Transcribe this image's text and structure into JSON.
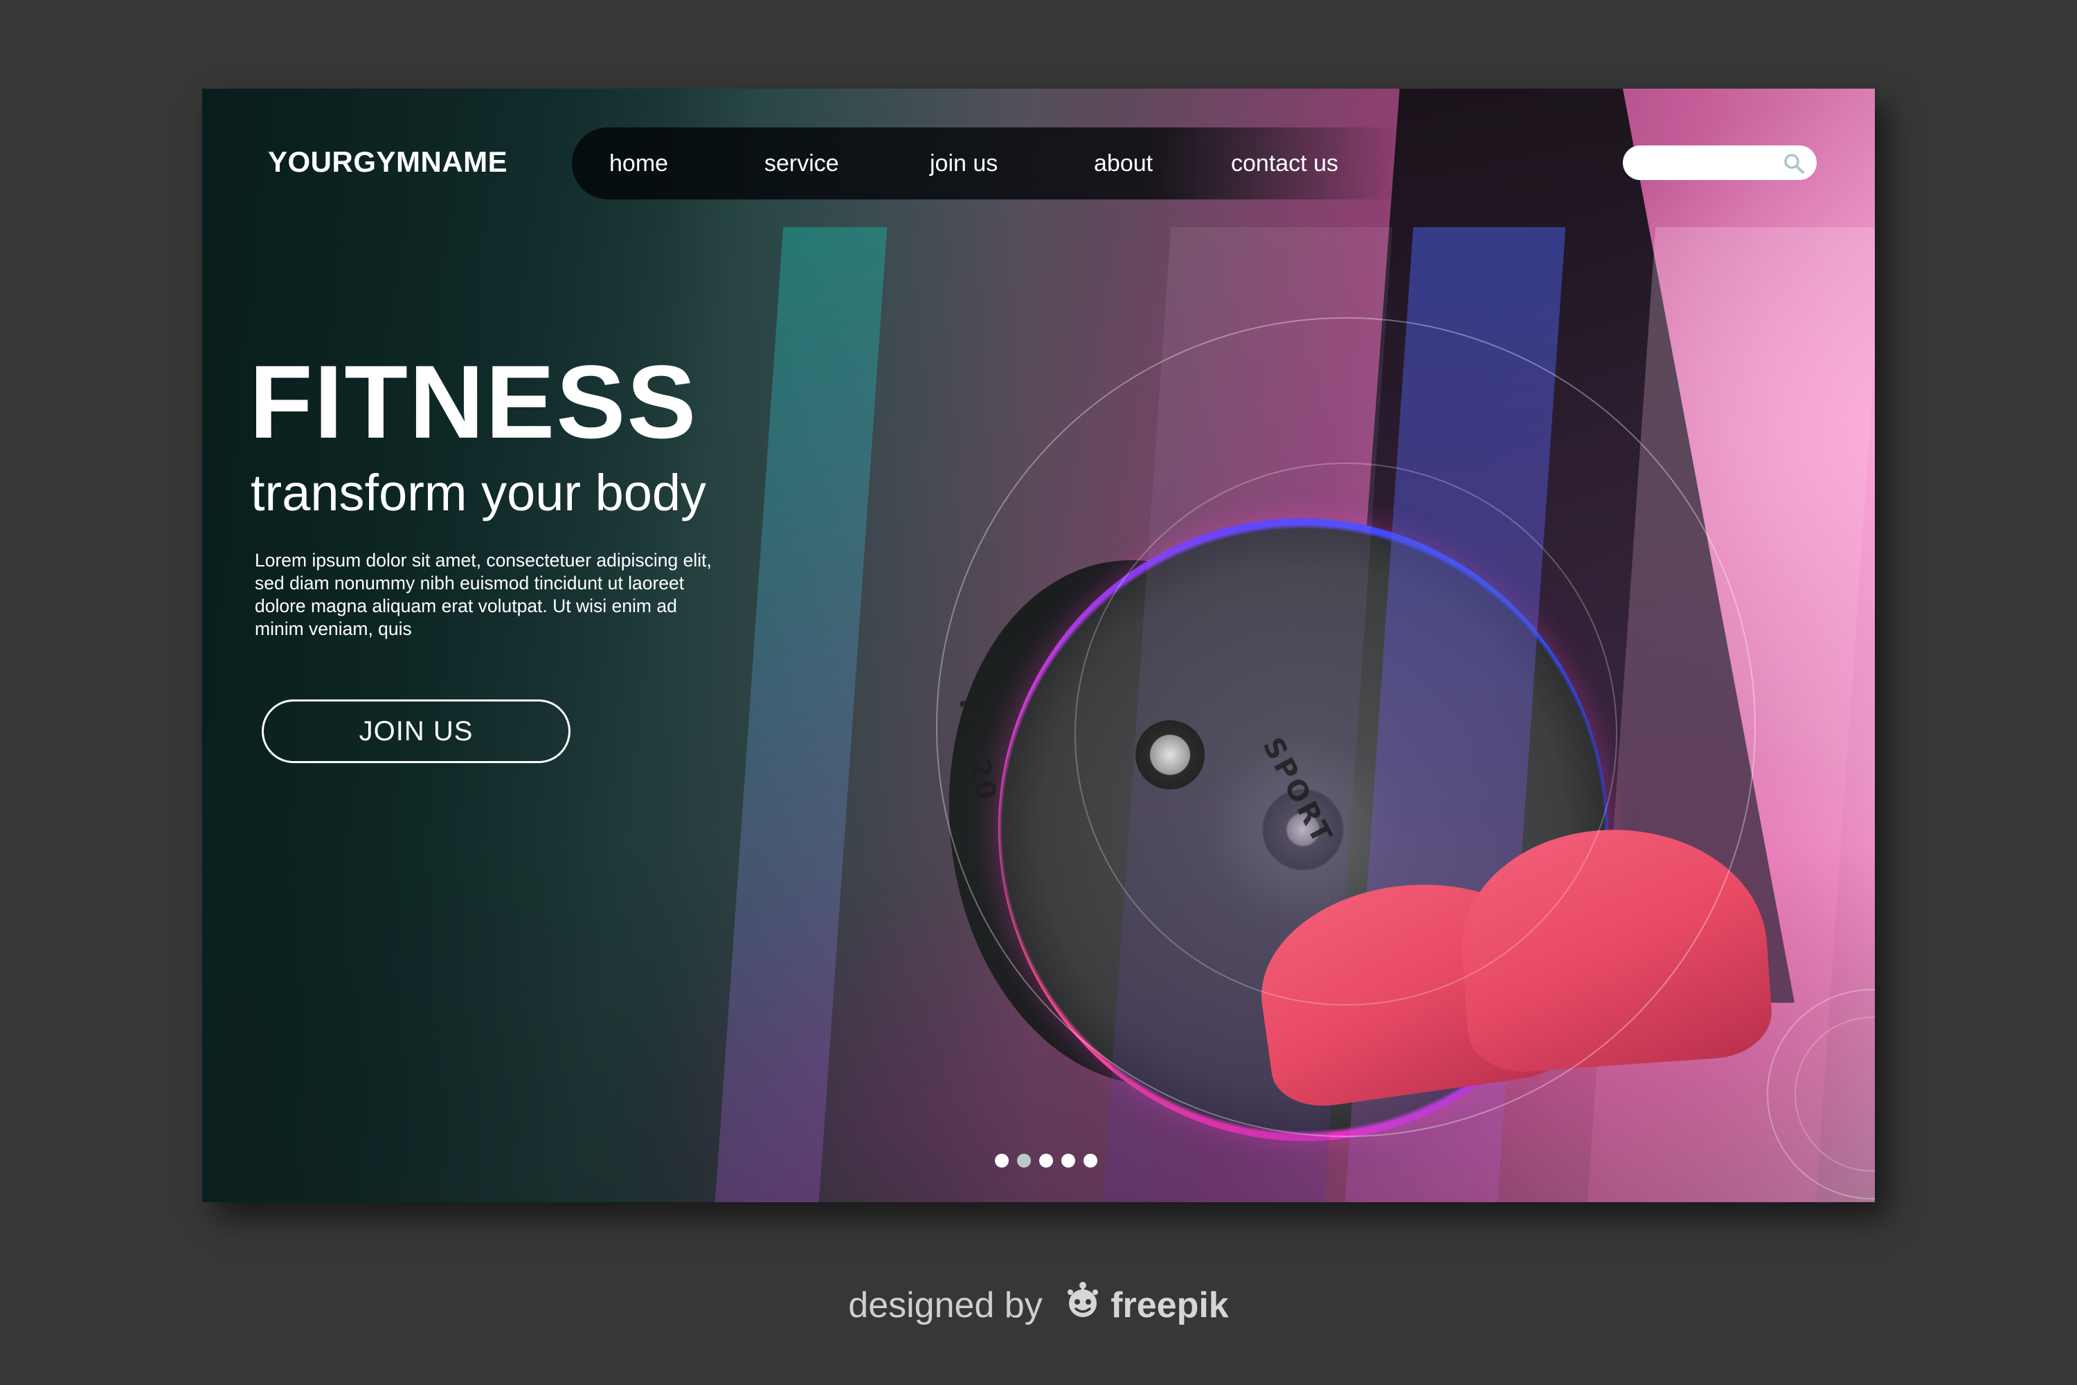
{
  "header": {
    "logo": "YOURGYMNAME",
    "nav": [
      {
        "label": "home"
      },
      {
        "label": "service"
      },
      {
        "label": "join us"
      },
      {
        "label": "about"
      },
      {
        "label": "contact us"
      }
    ],
    "search": {
      "value": "",
      "placeholder": "",
      "icon": "search-icon"
    }
  },
  "hero": {
    "title": "FITNESS",
    "subtitle": "transform your body",
    "body": "Lorem ipsum dolor sit amet, consectetuer adipiscing elit, sed diam nonummy nibh euismod tincidunt ut laoreet dolore magna aliquam erat volutpat. Ut wisi enim ad minim veniam, quis",
    "button": "JOIN US"
  },
  "image": {
    "plate_text_left": "KG 20",
    "plate_text_right": "SPORT"
  },
  "carousel": {
    "count": 5,
    "active_index": 1
  },
  "credit": {
    "prefix": "designed by",
    "brand": "freepik"
  },
  "colors": {
    "page_background": "#373737",
    "text_on_image": "#ffffff",
    "accent_magenta": "#ff2fb1",
    "accent_blue": "#2e55ff",
    "shoe_red": "#e84a64"
  }
}
